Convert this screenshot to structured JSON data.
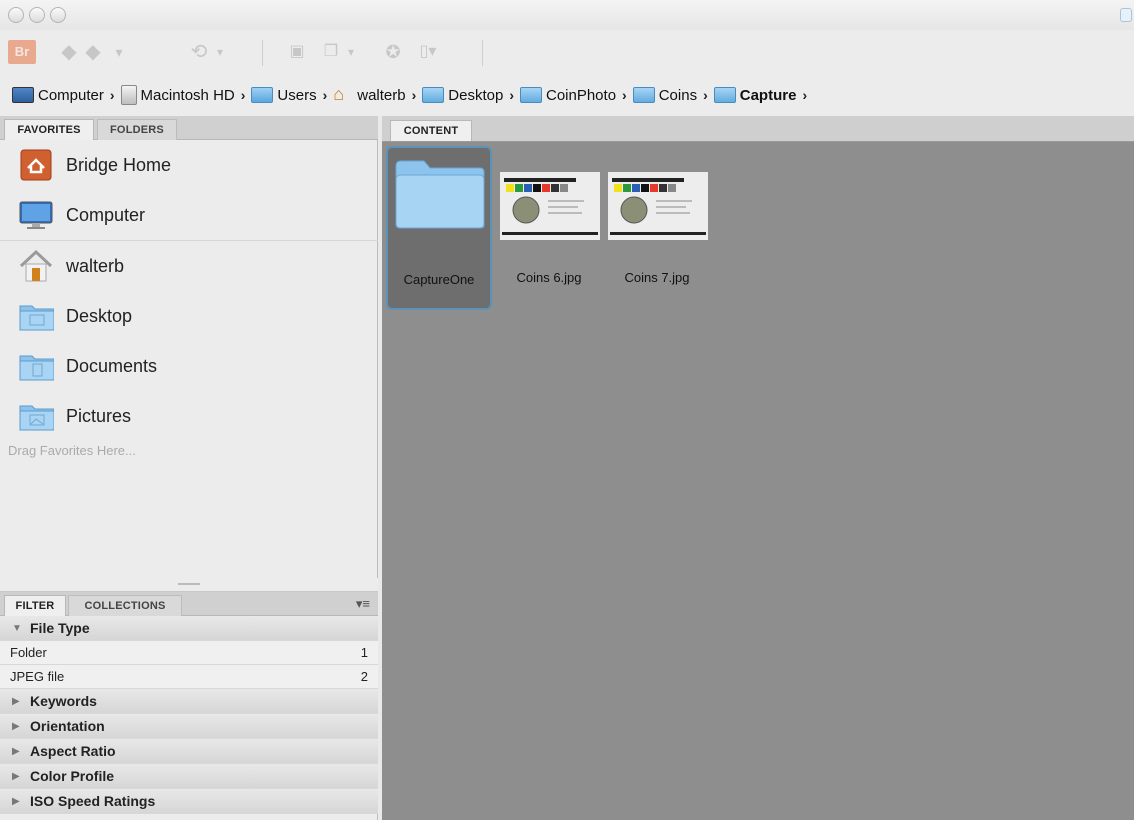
{
  "colors": {
    "window_bg": "#e9e9e9",
    "content_bg": "#8e8e8e",
    "selection_border": "#5b93b8",
    "folder_blue": "#8fc4eb"
  },
  "titlebar": {
    "buttons": [
      "close-icon",
      "minimize-icon",
      "zoom-icon"
    ]
  },
  "toolbar": {
    "logo_text": "Br",
    "icons": [
      "back-arrow-icon",
      "forward-arrow-icon",
      "history-dropdown-icon",
      "reveal-icon",
      "camera-import-icon",
      "refine-icon",
      "rotate-icon",
      "output-icon"
    ]
  },
  "breadcrumb": [
    {
      "label": "Computer",
      "icon": "computer-icon"
    },
    {
      "label": "Macintosh HD",
      "icon": "hard-drive-icon"
    },
    {
      "label": "Users",
      "icon": "users-folder-icon"
    },
    {
      "label": "walterb",
      "icon": "home-icon"
    },
    {
      "label": "Desktop",
      "icon": "folder-icon"
    },
    {
      "label": "CoinPhoto",
      "icon": "folder-icon"
    },
    {
      "label": "Coins",
      "icon": "folder-icon"
    },
    {
      "label": "Capture",
      "icon": "folder-icon"
    }
  ],
  "left_tabs": {
    "favorites": "FAVORITES",
    "folders": "FOLDERS"
  },
  "favorites": [
    {
      "label": "Bridge Home",
      "icon": "bridge-home-icon"
    },
    {
      "label": "Computer",
      "icon": "computer-icon"
    },
    {
      "label": "walterb",
      "icon": "home-icon"
    },
    {
      "label": "Desktop",
      "icon": "folder-icon"
    },
    {
      "label": "Documents",
      "icon": "folder-icon"
    },
    {
      "label": "Pictures",
      "icon": "folder-icon"
    }
  ],
  "drag_hint": "Drag Favorites Here...",
  "bottom_tabs": {
    "filter": "FILTER",
    "collections": "COLLECTIONS"
  },
  "filter": {
    "file_type_header": "File Type",
    "file_types": [
      {
        "label": "Folder",
        "count": "1"
      },
      {
        "label": "JPEG file",
        "count": "2"
      }
    ],
    "sections": [
      "Keywords",
      "Orientation",
      "Aspect Ratio",
      "Color Profile",
      "ISO Speed Ratings"
    ]
  },
  "content": {
    "tab_label": "CONTENT",
    "items": [
      {
        "name": "CaptureOne",
        "kind": "folder"
      },
      {
        "name": "Coins 6.jpg",
        "kind": "image"
      },
      {
        "name": "Coins 7.jpg",
        "kind": "image"
      }
    ]
  }
}
